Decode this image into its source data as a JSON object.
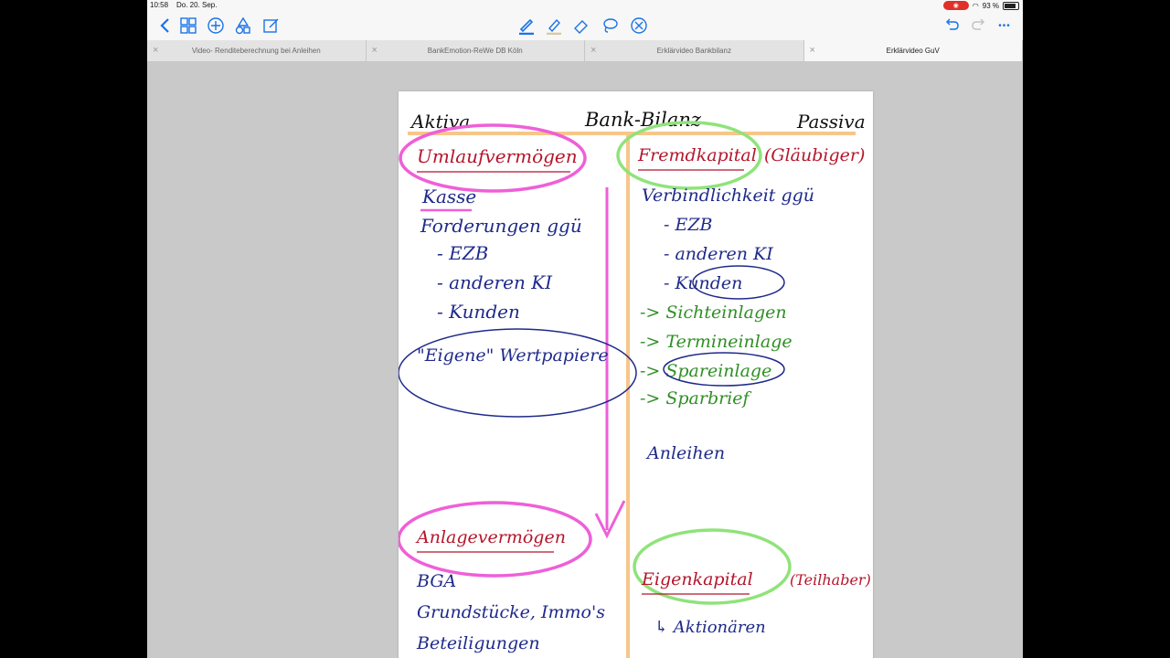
{
  "status": {
    "time": "10:58",
    "date": "Do. 20. Sep.",
    "battery": "93 %"
  },
  "toolbar": {
    "left_icons": [
      "back-chevron-icon",
      "grid-icon",
      "add-icon",
      "shapes-icon",
      "edit-icon"
    ],
    "center_icons": [
      "pen-icon",
      "highlighter-icon",
      "eraser-icon",
      "lasso-icon",
      "close-circle-icon"
    ],
    "right_icons": [
      "undo-icon",
      "redo-icon",
      "more-icon"
    ],
    "more_label": "•••"
  },
  "tabs": [
    {
      "label": "Video- Renditeberechnung bei Anleihen",
      "active": false
    },
    {
      "label": "BankEmotion-ReWe DB Köln",
      "active": false
    },
    {
      "label": "Erklärvideo Bankbilanz",
      "active": false
    },
    {
      "label": "Erklärvideo GuV",
      "active": true
    }
  ],
  "note": {
    "header": {
      "left": "Aktiva",
      "center": "Bank-Bilanz",
      "right": "Passiva"
    },
    "aktiva": {
      "umlauf": "Umlaufvermögen",
      "kasse": "Kasse",
      "forderungen": "Forderungen ggü",
      "f1": "- EZB",
      "f2": "- anderen KI",
      "f3": "- Kunden",
      "wertpapiere": "\"Eigene\" Wertpapiere",
      "anlage": "Anlagevermögen",
      "bga": "BGA",
      "grund": "Grundstücke, Immo's",
      "beteil": "Beteiligungen"
    },
    "passiva": {
      "fremd": "Fremdkapital",
      "glaeubiger": "(Gläubiger)",
      "verbind": "Verbindlichkeit ggü",
      "v1": "- EZB",
      "v2": "- anderen KI",
      "v3": "- Kunden",
      "sicht": "-> Sichteinlagen",
      "termin": "-> Termineinlage",
      "spar": "-> Spareinlage",
      "sparbrief": "-> Sparbrief",
      "anleihen": "Anleihen",
      "eigen": "Eigenkapital",
      "teilhaber": "(Teilhaber)",
      "aktionaere": "↳ Aktionären"
    },
    "colors": {
      "blue": "#1f2a8a",
      "red": "#b5152b",
      "green": "#2f8f24",
      "pink": "#ef5fd8",
      "lightgreen": "#8fe37a",
      "orange": "#f7c68a"
    }
  }
}
